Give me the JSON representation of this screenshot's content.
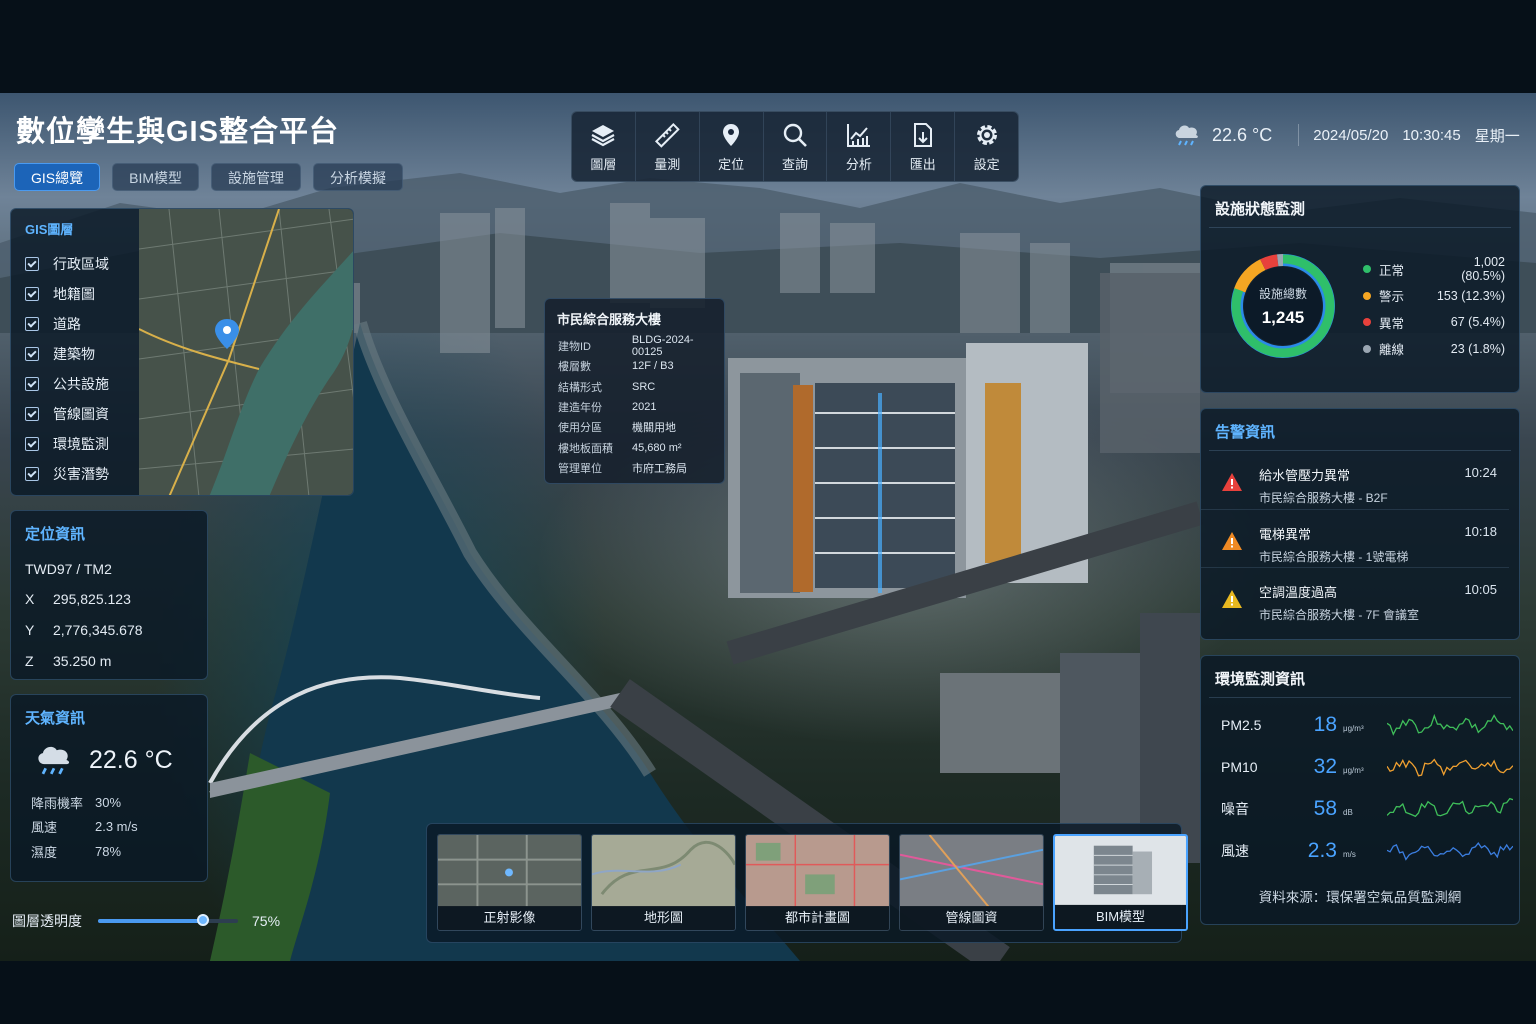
{
  "app": {
    "title": "數位孿生與GIS整合平台"
  },
  "tabs": [
    {
      "label": "GIS總覽",
      "active": true
    },
    {
      "label": "BIM模型"
    },
    {
      "label": "設施管理"
    },
    {
      "label": "分析模擬"
    }
  ],
  "toolbar": [
    {
      "label": "圖層",
      "icon": "layers-icon"
    },
    {
      "label": "量測",
      "icon": "ruler-icon"
    },
    {
      "label": "定位",
      "icon": "location-pin-icon"
    },
    {
      "label": "查詢",
      "icon": "search-icon"
    },
    {
      "label": "分析",
      "icon": "chart-icon"
    },
    {
      "label": "匯出",
      "icon": "export-icon"
    },
    {
      "label": "設定",
      "icon": "gear-icon"
    }
  ],
  "status": {
    "temp": "22.6 °C",
    "date": "2024/05/20",
    "time": "10:30:45",
    "weekday": "星期一",
    "icon": "rain-cloud-icon"
  },
  "gis_layers": {
    "title": "GIS圖層",
    "items": [
      "行政區域",
      "地籍圖",
      "道路",
      "建築物",
      "公共設施",
      "管線圖資",
      "環境監測",
      "災害潛勢"
    ]
  },
  "location": {
    "title": "定位資訊",
    "crs": "TWD97 / TM2",
    "rows": [
      {
        "k": "X",
        "v": "295,825.123"
      },
      {
        "k": "Y",
        "v": "2,776,345.678"
      },
      {
        "k": "Z",
        "v": "35.250 m"
      }
    ]
  },
  "weather": {
    "title": "天氣資訊",
    "temp": "22.6 °C",
    "rows": [
      {
        "k": "降雨機率",
        "v": "30%"
      },
      {
        "k": "風速",
        "v": "2.3 m/s"
      },
      {
        "k": "濕度",
        "v": "78%"
      }
    ]
  },
  "opacity": {
    "label": "圖層透明度",
    "value_text": "75%",
    "value": 0.75
  },
  "building": {
    "title": "市民綜合服務大樓",
    "rows": [
      {
        "k": "建物ID",
        "v": "BLDG-2024-00125"
      },
      {
        "k": "樓層數",
        "v": "12F / B3"
      },
      {
        "k": "結構形式",
        "v": "SRC"
      },
      {
        "k": "建造年份",
        "v": "2021"
      },
      {
        "k": "使用分區",
        "v": "機關用地"
      },
      {
        "k": "樓地板面積",
        "v": "45,680 m²"
      },
      {
        "k": "管理單位",
        "v": "市府工務局"
      }
    ]
  },
  "facility": {
    "title": "設施狀態監測",
    "total_label": "設施總數",
    "total": "1,245",
    "chart_data": {
      "type": "pie",
      "categories": [
        "正常",
        "警示",
        "異常",
        "離線"
      ],
      "values": [
        1002,
        153,
        67,
        23
      ],
      "labels": [
        "1,002 (80.5%)",
        "153 (12.3%)",
        "67 (5.4%)",
        "23 (1.8%)"
      ],
      "colors": [
        "#2fbf6a",
        "#f5a623",
        "#e8413c",
        "#9aa6b2"
      ]
    }
  },
  "alerts": {
    "title": "告警資訊",
    "items": [
      {
        "title": "給水管壓力異常",
        "sub": "市民綜合服務大樓 - B2F",
        "time": "10:24",
        "color": "#e8413c"
      },
      {
        "title": "電梯異常",
        "sub": "市民綜合服務大樓 - 1號電梯",
        "time": "10:18",
        "color": "#f08a24"
      },
      {
        "title": "空調溫度過高",
        "sub": "市民綜合服務大樓 - 7F 會議室",
        "time": "10:05",
        "color": "#e8b820"
      }
    ]
  },
  "environment": {
    "title": "環境監測資訊",
    "rows": [
      {
        "name": "PM2.5",
        "value": "18",
        "unit": "μg/m³",
        "color": "#3fbf5a"
      },
      {
        "name": "PM10",
        "value": "32",
        "unit": "μg/m³",
        "color": "#f0a030"
      },
      {
        "name": "噪音",
        "value": "58",
        "unit": "dB",
        "color": "#3fbf5a"
      },
      {
        "name": "風速",
        "value": "2.3",
        "unit": "m/s",
        "color": "#3b7ee0"
      }
    ],
    "source": "資料來源：環保署空氣品質監測網"
  },
  "basemaps": [
    {
      "label": "正射影像"
    },
    {
      "label": "地形圖"
    },
    {
      "label": "都市計畫圖"
    },
    {
      "label": "管線圖資"
    },
    {
      "label": "BIM模型",
      "active": true
    }
  ]
}
